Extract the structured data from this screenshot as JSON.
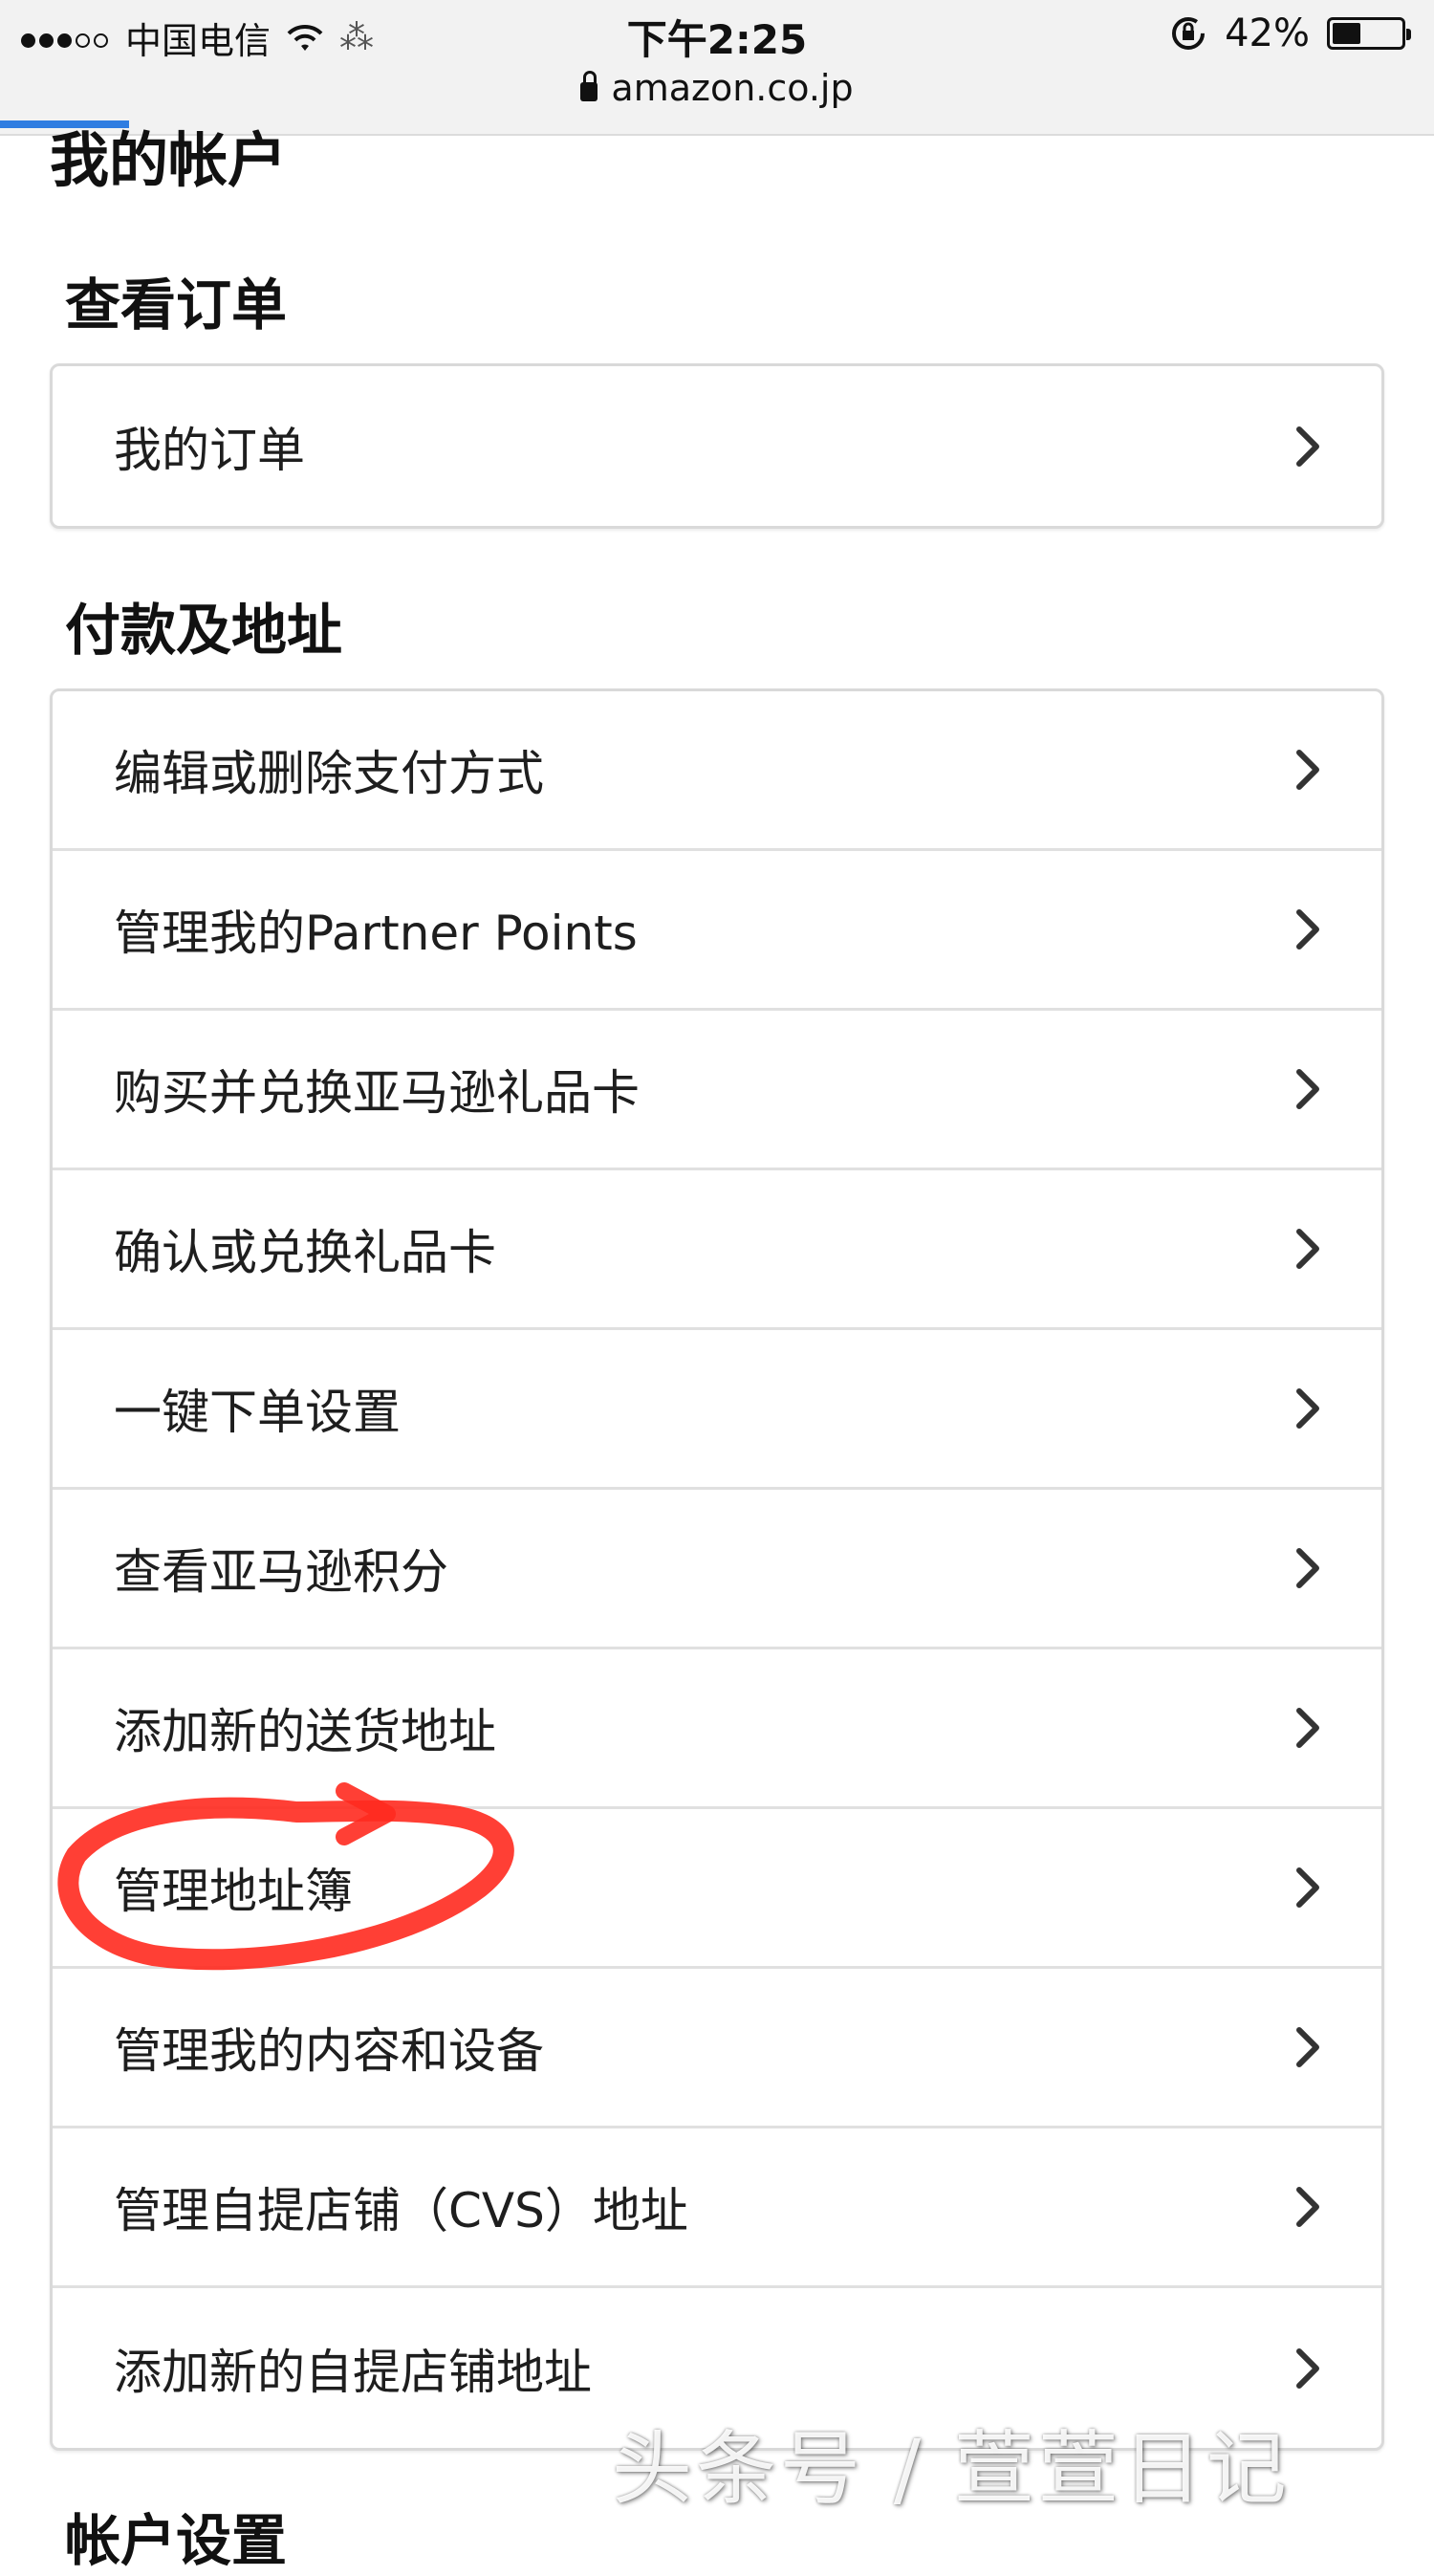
{
  "status_bar": {
    "carrier": "中国电信",
    "time": "下午2:25",
    "url": "amazon.co.jp",
    "battery": "42%",
    "battery_level": 0.42,
    "load_progress": 0.09
  },
  "page": {
    "title": "我的帐户"
  },
  "sections": [
    {
      "title": "查看订单",
      "items": [
        "我的订单"
      ]
    },
    {
      "title": "付款及地址",
      "items": [
        "编辑或删除支付方式",
        "管理我的Partner Points",
        "购买并兑换亚马逊礼品卡",
        "确认或兑换礼品卡",
        "一键下单设置",
        "查看亚马逊积分",
        "添加新的送货地址",
        "管理地址簿",
        "管理我的内容和设备",
        "管理自提店铺（CVS）地址",
        "添加新的自提店铺地址"
      ]
    },
    {
      "title": "帐户设置"
    }
  ],
  "annotation": {
    "color": "#ff2a1f",
    "highlighted_item": "管理地址簿"
  },
  "watermark": "头条号 / 萱萱日记",
  "icons": {
    "chevron": "chevron-right-icon",
    "lock": "lock-icon",
    "wifi": "wifi-icon"
  },
  "colors": {
    "accent": "#2f7de1",
    "card_border": "#d9d9d9",
    "chevron": "#333333"
  }
}
